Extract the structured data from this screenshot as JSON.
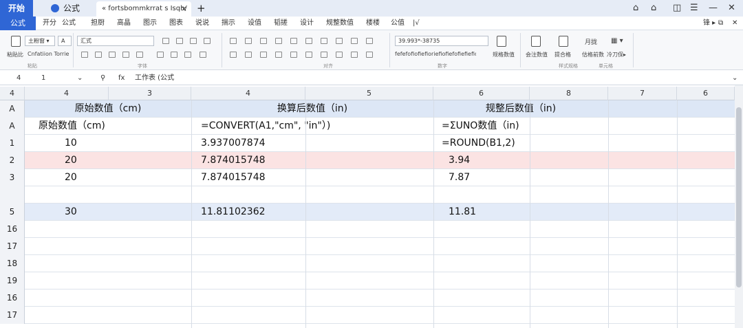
{
  "titlebar": {
    "start_tab": "开始",
    "doc_tab": "公式",
    "file_tab": "« fortsbommkrrat s Isqh/",
    "close_x": "×",
    "new_tab": "+"
  },
  "menu": {
    "formula_button": "公式",
    "items": [
      "开分",
      "公式",
      "担厨",
      "高晶",
      "图示",
      "图表",
      "说说",
      "揣示",
      "设值",
      "韬搓",
      "设计",
      "规整数值",
      "楼楼",
      "公值",
      "|√"
    ],
    "right_label": "锋 ▸"
  },
  "ribbon": {
    "clip_label1": "粘贴比",
    "clip_label2": "Cnfatiion Torrie",
    "clip_label3": "粘贴..",
    "clip_group": "粘贴",
    "font_name": "汇式",
    "font_size": "土粉窗 ▾",
    "font_group": "字体",
    "align_group": "对齐",
    "number_format": "39.993*-38735",
    "number_text": "fefefofiofiefioriefiofiefofiefiefio",
    "number_group": "数字",
    "cond_label": "规格数值",
    "style_group": "样式",
    "btn1": "会注数值",
    "btn2": "提合格",
    "btn3": "月拢",
    "btn4": "估格前数",
    "btn5": "冷刀保▸",
    "group_right1": "样式规格",
    "group_right2": "单元格"
  },
  "formula_bar": {
    "row_ref": "4",
    "cell_ref": "1",
    "fx_label": "fx",
    "content": "工作表   (公式"
  },
  "columns": [
    "4",
    "4",
    "3",
    "4",
    "5",
    "6",
    "8",
    "7",
    "6"
  ],
  "rows": [
    {
      "hdr": "A",
      "a": "原始数值（cm)",
      "b": "换算后数值（in)",
      "c": "规整后数值（in)",
      "style": "header"
    },
    {
      "hdr": "A",
      "a": "原始数值（cm)",
      "b": "=CONVERT(A1,\"cm\", \"in\"）)",
      "c": "=ΣUNO数值（in)",
      "style": "plain"
    },
    {
      "hdr": "1",
      "a": "10",
      "b": "3.937007874",
      "c": "=ROUND(B1,2)",
      "style": "plain"
    },
    {
      "hdr": "2",
      "a": "20",
      "b": "7.874015748",
      "c": "3.94",
      "style": "pink"
    },
    {
      "hdr": "3",
      "a": "20",
      "b": "7.874015748",
      "c": "7.87",
      "style": "plain"
    },
    {
      "hdr": "",
      "a": "",
      "b": "",
      "c": "",
      "style": "plain"
    },
    {
      "hdr": "5",
      "a": "30",
      "b": "11.81102362",
      "c": "11.81",
      "style": "blue"
    },
    {
      "hdr": "16",
      "a": "",
      "b": "",
      "c": "",
      "style": "plain"
    },
    {
      "hdr": "17",
      "a": "",
      "b": "",
      "c": "",
      "style": "plain"
    },
    {
      "hdr": "18",
      "a": "",
      "b": "",
      "c": "",
      "style": "plain"
    },
    {
      "hdr": "19",
      "a": "",
      "b": "",
      "c": "",
      "style": "plain"
    },
    {
      "hdr": "16",
      "a": "",
      "b": "",
      "c": "",
      "style": "plain"
    },
    {
      "hdr": "17",
      "a": "",
      "b": "",
      "c": "",
      "style": "plain"
    }
  ],
  "colors": {
    "accent": "#2f66d5",
    "header_row": "#dde7f6",
    "pink_row": "#fbe3e3",
    "blue_row": "#e3ebf8"
  }
}
